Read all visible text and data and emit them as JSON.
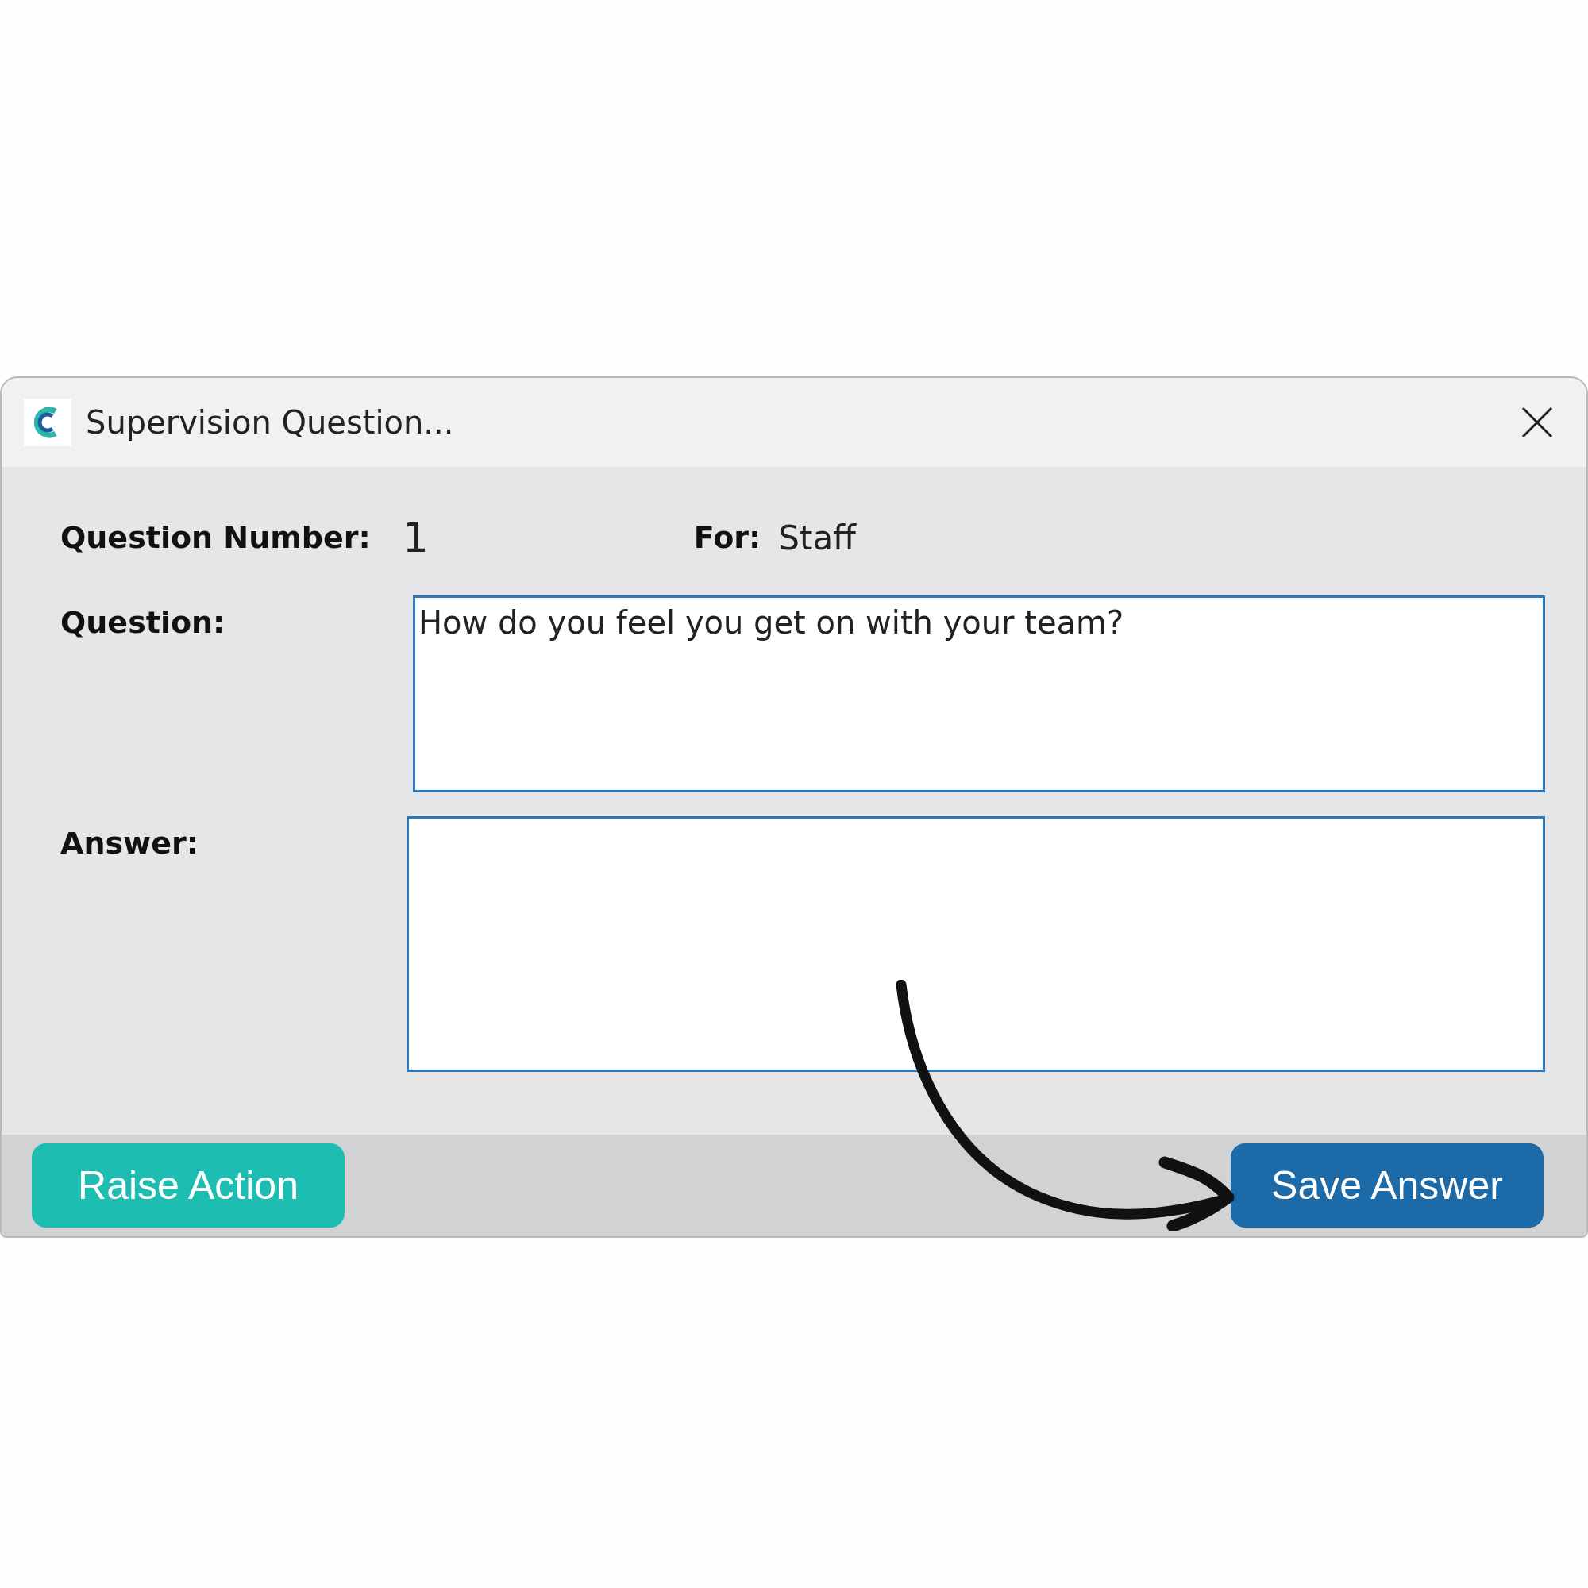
{
  "window": {
    "title": "Supervision Question..."
  },
  "fields": {
    "question_number_label": "Question Number:",
    "question_number": "1",
    "for_label": "For:",
    "for_value": "Staff"
  },
  "question": {
    "label": "Question:",
    "value": "How do you feel you get on with your team?"
  },
  "answer": {
    "label": "Answer:"
  },
  "buttons": [
    {
      "label": "Raise Action",
      "kind": "secondary"
    },
    {
      "label": "Save Answer",
      "kind": "primary"
    }
  ]
}
